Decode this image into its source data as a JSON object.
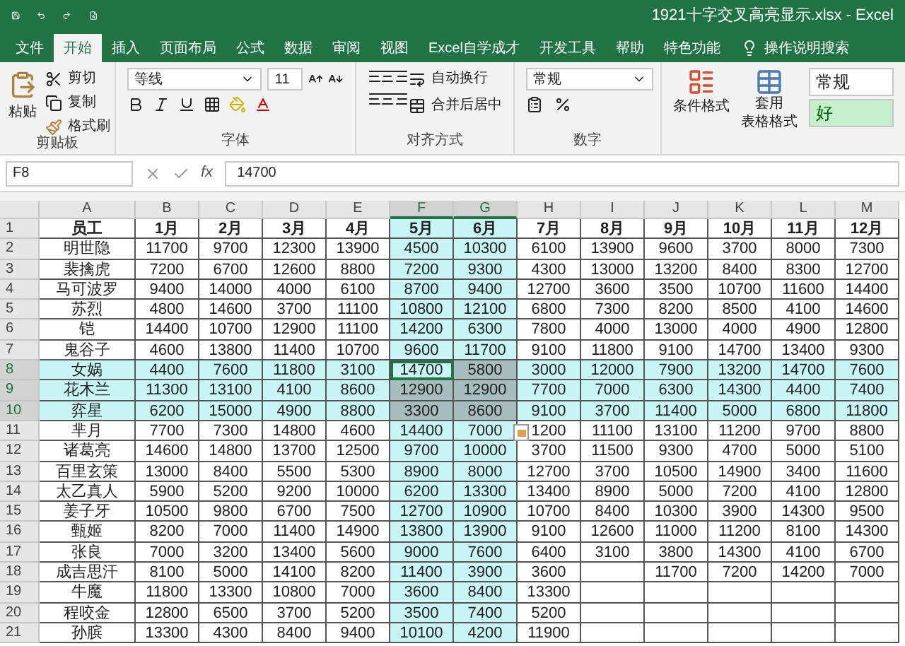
{
  "window": {
    "title": "1921十字交叉高亮显示.xlsx  -  Excel"
  },
  "menu_tabs": [
    {
      "label": "文件",
      "selected": false
    },
    {
      "label": "开始",
      "selected": true
    },
    {
      "label": "插入",
      "selected": false
    },
    {
      "label": "页面布局",
      "selected": false
    },
    {
      "label": "公式",
      "selected": false
    },
    {
      "label": "数据",
      "selected": false
    },
    {
      "label": "审阅",
      "selected": false
    },
    {
      "label": "视图",
      "selected": false
    },
    {
      "label": "Excel自学成才",
      "selected": false
    },
    {
      "label": "开发工具",
      "selected": false
    },
    {
      "label": "帮助",
      "selected": false
    },
    {
      "label": "特色功能",
      "selected": false
    }
  ],
  "tell_me": "操作说明搜索",
  "ribbon": {
    "clipboard": {
      "paste": "粘贴",
      "cut": "剪切",
      "copy": "复制",
      "format_painter": "格式刷",
      "label": "剪贴板"
    },
    "font": {
      "name": "等线",
      "size": "11",
      "label": "字体"
    },
    "alignment": {
      "wrap": "自动换行",
      "merge": "合并后居中",
      "label": "对齐方式"
    },
    "number": {
      "format": "常规",
      "label": "数字"
    },
    "styles": {
      "conditional": "条件格式",
      "table_format": [
        "套用",
        "表格格式"
      ],
      "cell_styles": [
        "常规",
        "好"
      ]
    }
  },
  "formula_bar": {
    "name_box": "F8",
    "fx": "fx",
    "value": "14700"
  },
  "sheet": {
    "columns": [
      {
        "letter": "A",
        "selected": false
      },
      {
        "letter": "B",
        "selected": false
      },
      {
        "letter": "C",
        "selected": false
      },
      {
        "letter": "D",
        "selected": false
      },
      {
        "letter": "E",
        "selected": false
      },
      {
        "letter": "F",
        "selected": true
      },
      {
        "letter": "G",
        "selected": true
      },
      {
        "letter": "H",
        "selected": false
      },
      {
        "letter": "I",
        "selected": false
      },
      {
        "letter": "J",
        "selected": false
      },
      {
        "letter": "K",
        "selected": false
      },
      {
        "letter": "L",
        "selected": false
      },
      {
        "letter": "M",
        "selected": false
      }
    ],
    "rows": [
      {
        "number": "1",
        "kind": "header",
        "selected": false,
        "cells": [
          "员工",
          "1月",
          "2月",
          "3月",
          "4月",
          "5月",
          "6月",
          "7月",
          "8月",
          "9月",
          "10月",
          "11月",
          "12月"
        ]
      },
      {
        "number": "2",
        "kind": "data",
        "selected": false,
        "cells": [
          "明世隐",
          "11700",
          "9700",
          "12300",
          "13900",
          "4500",
          "10300",
          "6100",
          "13900",
          "9600",
          "3700",
          "8000",
          "7300"
        ]
      },
      {
        "number": "3",
        "kind": "data",
        "selected": false,
        "cells": [
          "裴擒虎",
          "7200",
          "6700",
          "12600",
          "8800",
          "7200",
          "9300",
          "4300",
          "13000",
          "13200",
          "8400",
          "8300",
          "12700"
        ]
      },
      {
        "number": "4",
        "kind": "data",
        "selected": false,
        "cells": [
          "马可波罗",
          "9400",
          "14000",
          "4000",
          "6100",
          "8700",
          "9400",
          "12700",
          "3600",
          "3500",
          "10700",
          "11600",
          "14400"
        ]
      },
      {
        "number": "5",
        "kind": "data",
        "selected": false,
        "cells": [
          "苏烈",
          "4800",
          "14600",
          "3700",
          "11100",
          "10800",
          "12100",
          "6800",
          "7300",
          "8200",
          "8500",
          "4100",
          "14600"
        ]
      },
      {
        "number": "6",
        "kind": "data",
        "selected": false,
        "cells": [
          "铠",
          "14400",
          "10700",
          "12900",
          "11100",
          "14200",
          "6300",
          "7800",
          "4000",
          "13000",
          "4000",
          "4900",
          "12800"
        ]
      },
      {
        "number": "7",
        "kind": "data",
        "selected": false,
        "cells": [
          "鬼谷子",
          "4600",
          "13800",
          "11400",
          "10700",
          "9600",
          "11700",
          "9100",
          "11800",
          "9100",
          "14700",
          "13400",
          "9300"
        ]
      },
      {
        "number": "8",
        "kind": "data",
        "selected": true,
        "cells": [
          "女娲",
          "4400",
          "7600",
          "11800",
          "3100",
          "14700",
          "5800",
          "3000",
          "12000",
          "7900",
          "13200",
          "14700",
          "7600"
        ]
      },
      {
        "number": "9",
        "kind": "data",
        "selected": true,
        "cells": [
          "花木兰",
          "11300",
          "13100",
          "4100",
          "8600",
          "12900",
          "12900",
          "7700",
          "7000",
          "6300",
          "14300",
          "4400",
          "7400"
        ]
      },
      {
        "number": "10",
        "kind": "data",
        "selected": true,
        "cells": [
          "弈星",
          "6200",
          "15000",
          "4900",
          "8800",
          "3300",
          "8600",
          "9100",
          "3700",
          "11400",
          "5000",
          "6800",
          "11800"
        ]
      },
      {
        "number": "11",
        "kind": "data",
        "selected": false,
        "cells": [
          "芈月",
          "7700",
          "7300",
          "14800",
          "4600",
          "14400",
          "7000",
          "1200",
          "11100",
          "13100",
          "11200",
          "9700",
          "8800"
        ]
      },
      {
        "number": "12",
        "kind": "data",
        "selected": false,
        "cells": [
          "诸葛亮",
          "14600",
          "14800",
          "13700",
          "12500",
          "9700",
          "10000",
          "3700",
          "11500",
          "9300",
          "4700",
          "5000",
          "5100"
        ]
      },
      {
        "number": "13",
        "kind": "data",
        "selected": false,
        "cells": [
          "百里玄策",
          "13000",
          "8400",
          "5500",
          "5300",
          "8900",
          "8000",
          "12700",
          "3700",
          "10500",
          "14900",
          "3400",
          "11600"
        ]
      },
      {
        "number": "14",
        "kind": "data",
        "selected": false,
        "cells": [
          "太乙真人",
          "5900",
          "5200",
          "9200",
          "10000",
          "6200",
          "13300",
          "13400",
          "8900",
          "5000",
          "7200",
          "4100",
          "12800"
        ]
      },
      {
        "number": "15",
        "kind": "data",
        "selected": false,
        "cells": [
          "姜子牙",
          "10500",
          "9800",
          "6700",
          "7500",
          "12700",
          "10900",
          "10700",
          "8400",
          "10300",
          "3900",
          "14300",
          "9500"
        ]
      },
      {
        "number": "16",
        "kind": "data",
        "selected": false,
        "cells": [
          "甄姬",
          "8200",
          "7000",
          "11400",
          "14900",
          "13800",
          "13900",
          "9100",
          "12600",
          "11000",
          "11200",
          "8100",
          "14300"
        ]
      },
      {
        "number": "17",
        "kind": "data",
        "selected": false,
        "cells": [
          "张良",
          "7000",
          "3200",
          "13400",
          "5600",
          "9000",
          "7600",
          "6400",
          "3100",
          "3800",
          "14300",
          "4100",
          "6700"
        ]
      },
      {
        "number": "18",
        "kind": "data",
        "selected": false,
        "cells": [
          "成吉思汗",
          "8100",
          "5000",
          "14100",
          "8200",
          "11400",
          "3900",
          "3600",
          null,
          "11700",
          "7200",
          "14200",
          "7000"
        ]
      },
      {
        "number": "19",
        "kind": "data",
        "selected": false,
        "cells": [
          "牛魔",
          "11800",
          "13300",
          "10800",
          "7000",
          "3600",
          "8400",
          "13300",
          null,
          null,
          null,
          null,
          null
        ]
      },
      {
        "number": "20",
        "kind": "data",
        "selected": false,
        "cells": [
          "程咬金",
          "12800",
          "6500",
          "3700",
          "5200",
          "3500",
          "7400",
          "5200",
          null,
          null,
          null,
          null,
          null
        ]
      },
      {
        "number": "21",
        "kind": "data",
        "selected": false,
        "cells": [
          "孙膑",
          "13300",
          "4300",
          "8400",
          "9400",
          "10100",
          "4200",
          "11900",
          null,
          null,
          null,
          null,
          null
        ]
      }
    ]
  }
}
